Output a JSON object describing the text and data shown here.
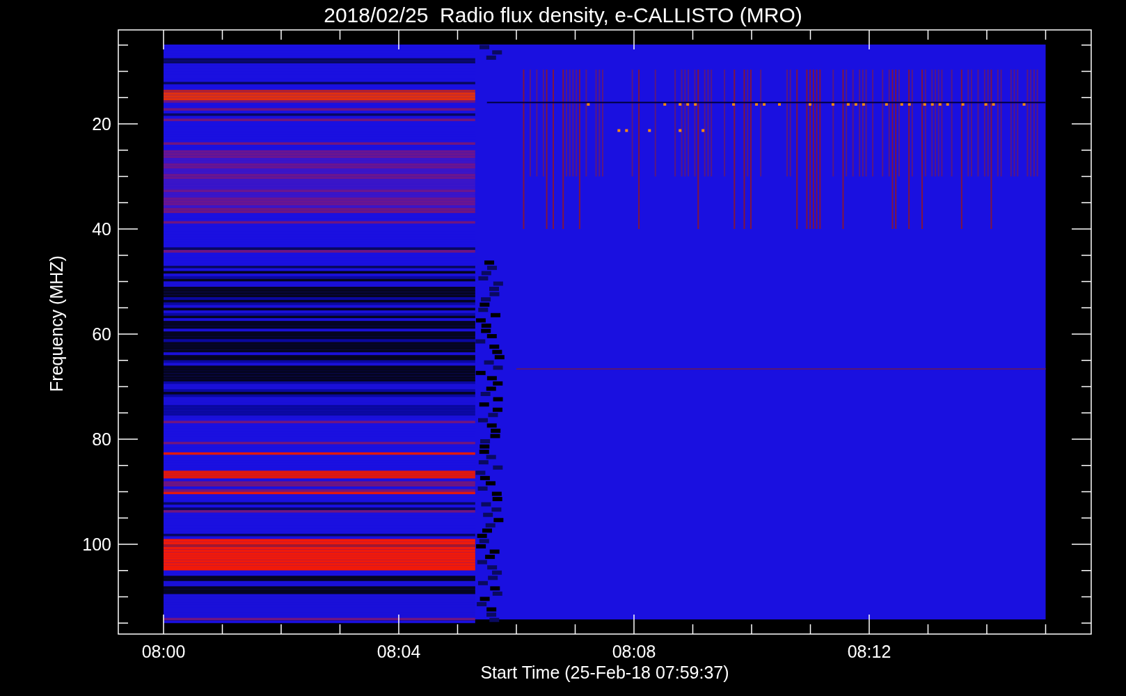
{
  "plot": {
    "title": "2018/02/25  Radio flux density, e-CALLISTO (MRO)",
    "ylabel": "Frequency (MHZ)",
    "xlabel": "Start Time (25-Feb-18 07:59:37)",
    "y_tick_labels": [
      "20",
      "40",
      "60",
      "80",
      "100"
    ],
    "x_tick_labels": [
      "08:00",
      "08:04",
      "08:08",
      "08:12"
    ]
  }
}
